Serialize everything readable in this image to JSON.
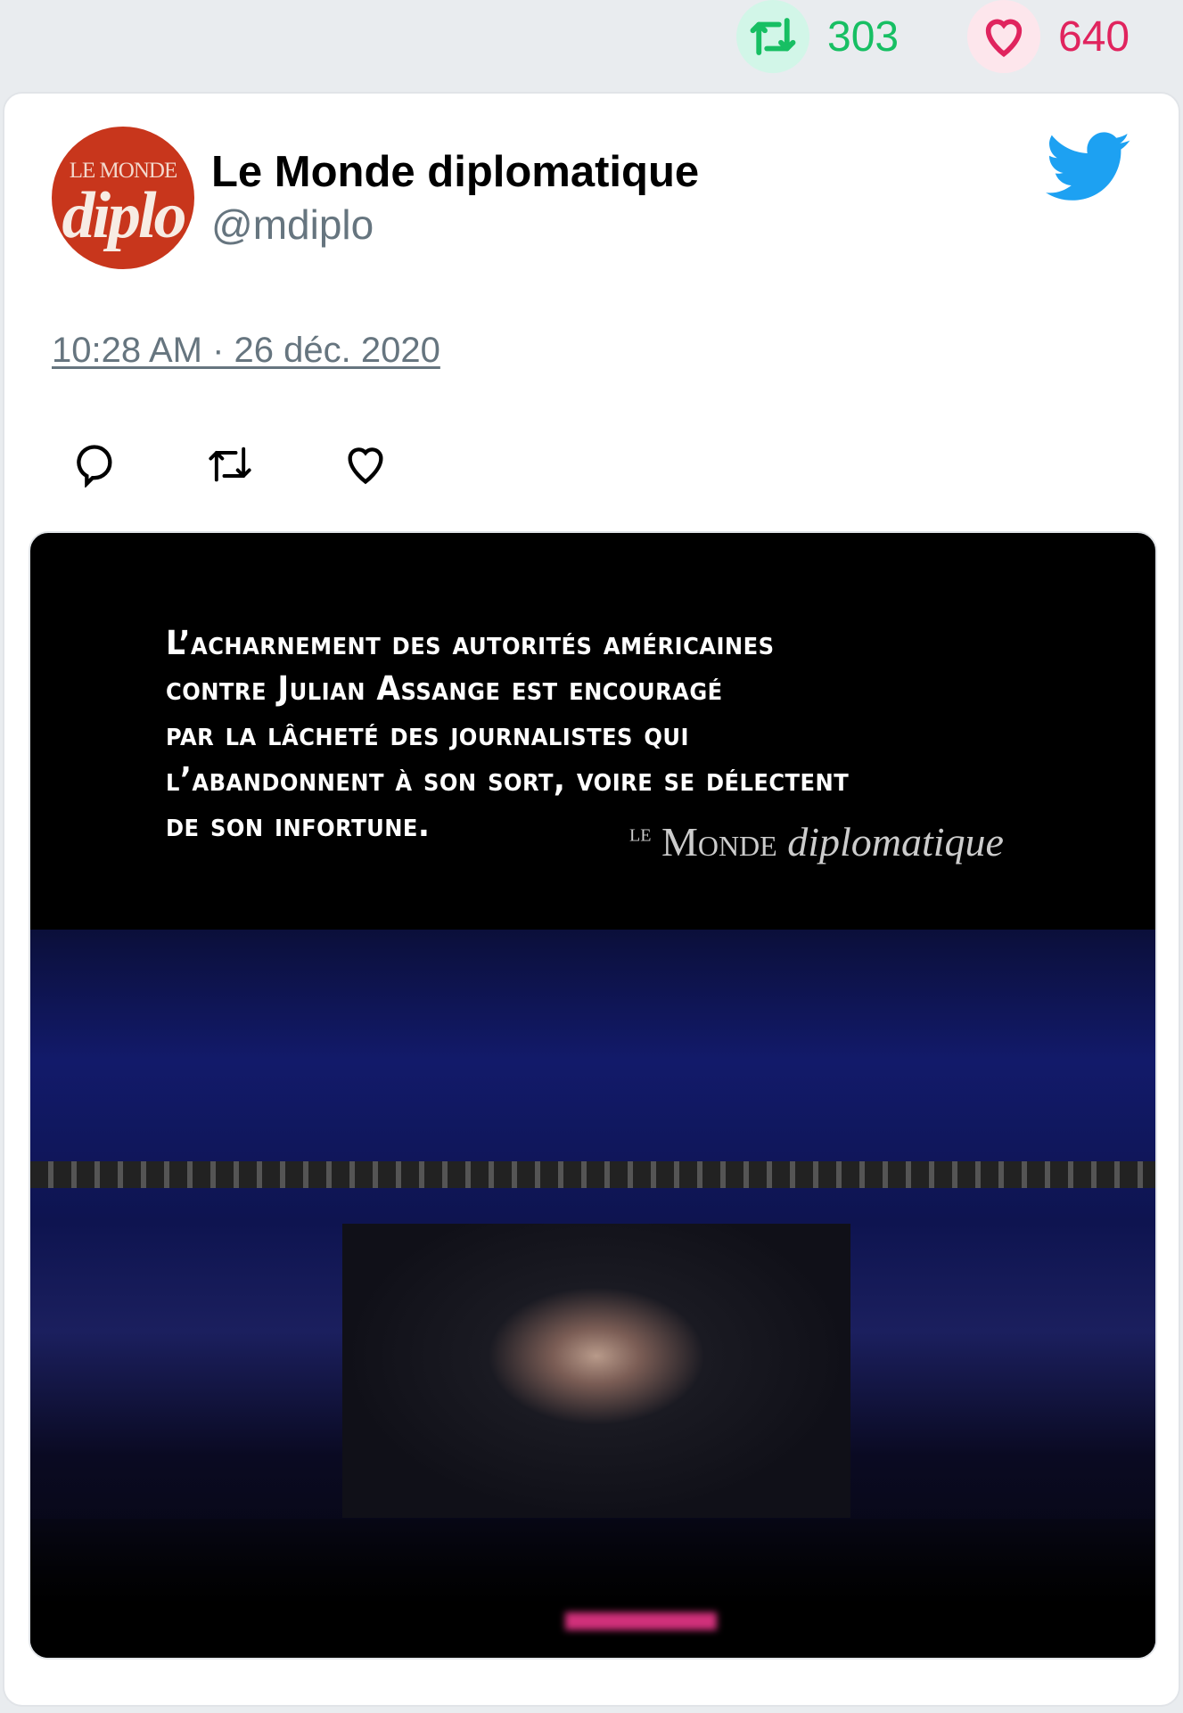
{
  "stats": {
    "retweets": "303",
    "likes": "640",
    "retweet_icon": "retweet-icon",
    "like_icon": "heart-icon"
  },
  "tweet": {
    "author_name": "Le Monde diplomatique",
    "handle": "@mdiplo",
    "avatar": {
      "line1": "LE MONDE",
      "line2": "diplo"
    },
    "timestamp": "10:28 AM · 26 déc. 2020",
    "actions": [
      "reply-icon",
      "retweet-icon",
      "like-icon"
    ],
    "media": {
      "quote_lines": [
        "L’acharnement des autorités américaines",
        "contre Julian Assange est encouragé",
        "par la lâcheté des journalistes qui",
        "l’abandonnent à son sort, voire se délectent",
        "de son infortune."
      ],
      "signature": {
        "le": "LE",
        "monde": "Monde",
        "diplo": "diplomatique"
      }
    }
  },
  "colors": {
    "retweet": "#17bf63",
    "like": "#e0245e",
    "twitter_blue": "#1da1f2",
    "muted": "#66757f"
  }
}
